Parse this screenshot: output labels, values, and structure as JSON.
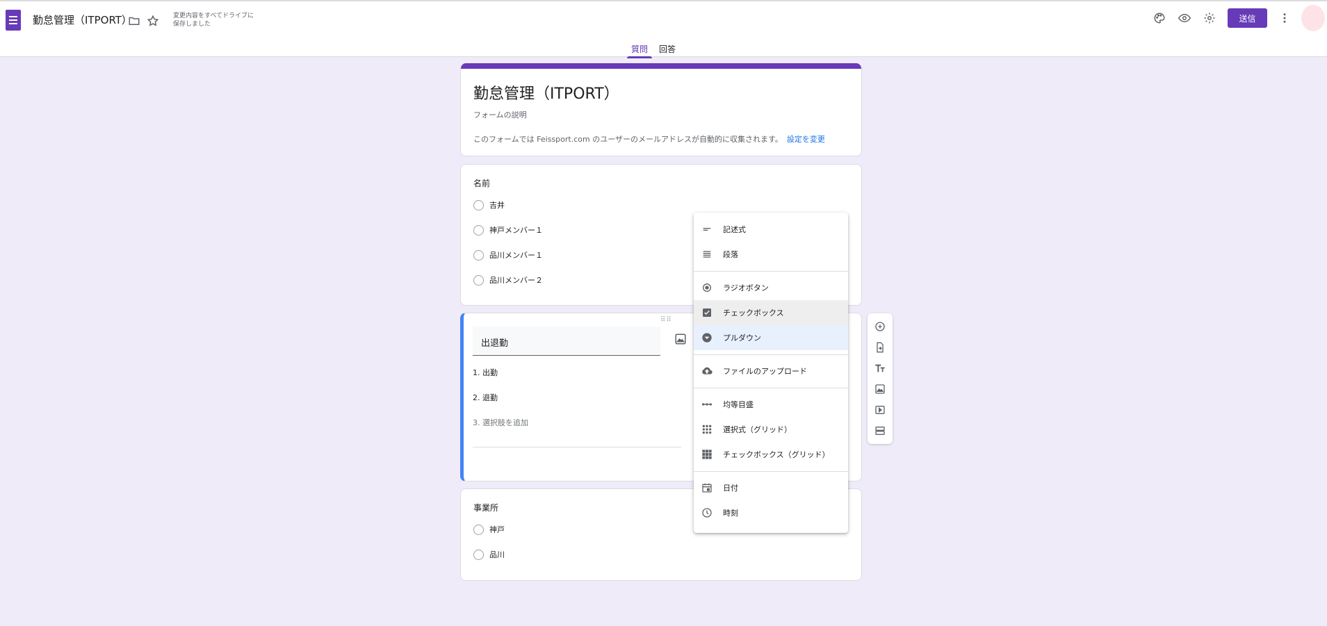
{
  "header": {
    "form_title": "勤怠管理（ITPORT）",
    "save_status_line1": "変更内容をすべてドライブに",
    "save_status_line2": "保存しました",
    "send_label": "送信",
    "tabs": [
      {
        "label": "質問",
        "active": true
      },
      {
        "label": "回答",
        "active": false
      }
    ],
    "icons": [
      "folder-icon",
      "star-icon",
      "palette-icon",
      "preview-icon",
      "settings-icon",
      "more-vert-icon"
    ],
    "accent_color": "#673ab7"
  },
  "title_card": {
    "title": "勤怠管理（ITPORT）",
    "description": "フォームの説明",
    "email_note": "このフォームでは Feissport.com のユーザーのメールアドレスが自動的に収集されます。",
    "email_link": "設定を変更"
  },
  "questions": [
    {
      "title": "名前",
      "options": [
        "吉井",
        "神戸メンバー１",
        "品川メンバー１",
        "品川メンバー２"
      ]
    },
    {
      "title": "出退勤",
      "options": [
        "1.  出勤",
        "2.  退勤"
      ],
      "add_option": "3.  選択肢を追加"
    },
    {
      "title": "事業所",
      "options": [
        "神戸",
        "品川"
      ]
    }
  ],
  "type_menu": {
    "items": [
      {
        "label": "記述式",
        "icon": "short-text-icon"
      },
      {
        "label": "段落",
        "icon": "paragraph-icon"
      },
      {
        "label": "ラジオボタン",
        "icon": "radio-button-icon"
      },
      {
        "label": "チェックボックス",
        "icon": "checkbox-icon",
        "state": "hover"
      },
      {
        "label": "プルダウン",
        "icon": "dropdown-icon",
        "state": "selected"
      },
      {
        "label": "ファイルのアップロード",
        "icon": "cloud-upload-icon"
      },
      {
        "label": "均等目盛",
        "icon": "linear-scale-icon"
      },
      {
        "label": "選択式（グリッド）",
        "icon": "grid-dots-icon"
      },
      {
        "label": "チェックボックス（グリッド）",
        "icon": "grid-check-icon"
      },
      {
        "label": "日付",
        "icon": "calendar-icon"
      },
      {
        "label": "時刻",
        "icon": "clock-icon"
      }
    ]
  },
  "side_toolbar": {
    "tools": [
      "add-question-icon",
      "import-questions-icon",
      "add-title-icon",
      "add-image-icon",
      "add-video-icon",
      "add-section-icon"
    ]
  }
}
